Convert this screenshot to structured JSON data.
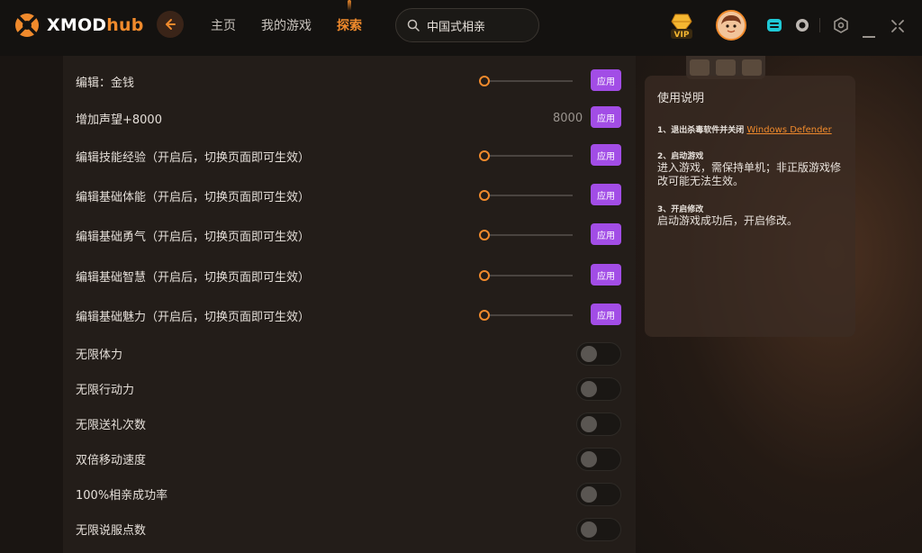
{
  "app": {
    "logo_text_x": "XMOD",
    "logo_text_hub": "hub"
  },
  "nav": {
    "items": [
      {
        "label": "主页",
        "active": false
      },
      {
        "label": "我的游戏",
        "active": false
      },
      {
        "label": "探索",
        "active": true
      }
    ]
  },
  "search": {
    "value": "中国式相亲"
  },
  "badge": {
    "vip_label": "VIP"
  },
  "colors": {
    "accent": "#f08a2c",
    "apply_button": "#a24de6"
  },
  "cheats": {
    "apply_label": "应用",
    "slider_rows": [
      {
        "label": "编辑：金钱",
        "kind": "slider"
      },
      {
        "label": "增加声望+8000",
        "kind": "value",
        "value": "8000"
      },
      {
        "label": "编辑技能经验（开启后，切换页面即可生效）",
        "kind": "slider"
      },
      {
        "label": "编辑基础体能（开启后，切换页面即可生效）",
        "kind": "slider"
      },
      {
        "label": "编辑基础勇气（开启后，切换页面即可生效）",
        "kind": "slider"
      },
      {
        "label": "编辑基础智慧（开启后，切换页面即可生效）",
        "kind": "slider"
      },
      {
        "label": "编辑基础魅力（开启后，切换页面即可生效）",
        "kind": "slider"
      }
    ],
    "toggle_rows": [
      {
        "label": "无限体力",
        "on": false
      },
      {
        "label": "无限行动力",
        "on": false
      },
      {
        "label": "无限送礼次数",
        "on": false
      },
      {
        "label": "双倍移动速度",
        "on": false
      },
      {
        "label": "100%相亲成功率",
        "on": false
      },
      {
        "label": "无限说服点数",
        "on": false
      }
    ]
  },
  "instructions": {
    "title": "使用说明",
    "step1_title": "1、退出杀毒软件并关闭",
    "step1_link": "Windows Defender",
    "step2_title": "2、启动游戏",
    "step2_body": "进入游戏，需保持单机；非正版游戏修改可能无法生效。",
    "step3_title": "3、开启修改",
    "step3_body": "启动游戏成功后，开启修改。"
  }
}
